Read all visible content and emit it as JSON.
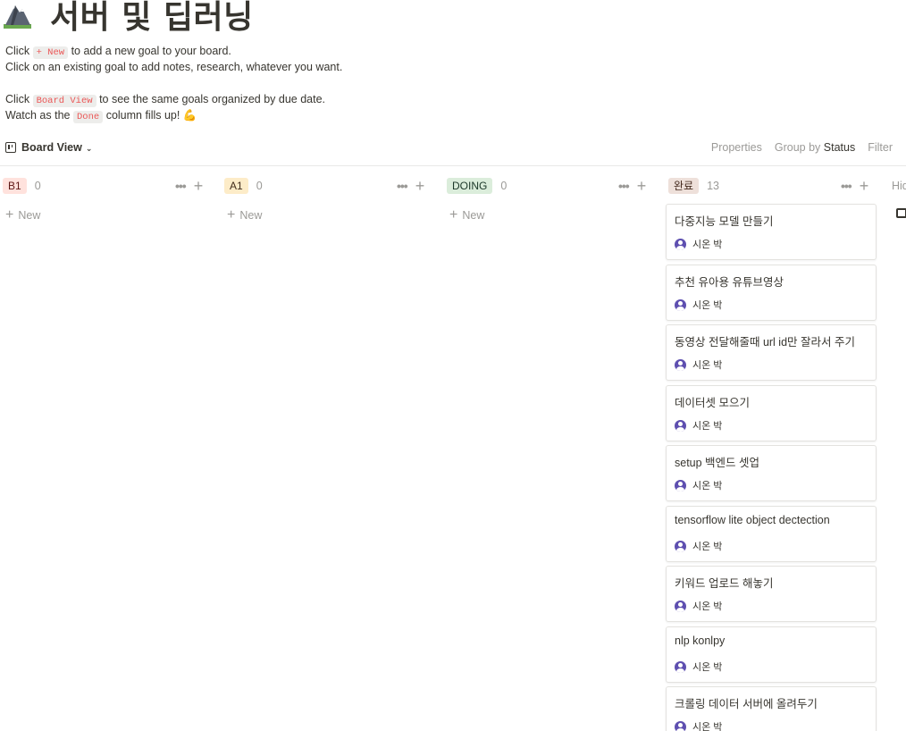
{
  "page": {
    "icon": "mountain-icon",
    "title": "서버 및 딥러닝"
  },
  "description": {
    "line1_prefix": "Click",
    "line1_code": "+ New",
    "line1_suffix": "to add a new goal to your board.",
    "line2": "Click on an existing goal to add notes, research, whatever you want.",
    "line3_prefix": "Click",
    "line3_code": "Board View",
    "line3_suffix": "to see the same goals organized by due date.",
    "line4_prefix": "Watch as the",
    "line4_code": "Done",
    "line4_suffix": "column fills up! 💪"
  },
  "view": {
    "name": "Board View",
    "properties": "Properties",
    "group_by_label": "Group by",
    "group_by_value": "Status",
    "filter": "Filter"
  },
  "columns": [
    {
      "label": "B1",
      "count": "0",
      "tag_bg": "#ffe2dd",
      "tag_color": "#5d1715",
      "new_label": "New"
    },
    {
      "label": "A1",
      "count": "0",
      "tag_bg": "#fdecc8",
      "tag_color": "#402c1b",
      "new_label": "New"
    },
    {
      "label": "DOING",
      "count": "0",
      "tag_bg": "#dbeddb",
      "tag_color": "#1c3829",
      "new_label": "New"
    },
    {
      "label": "완료",
      "count": "13",
      "tag_bg": "#eee0da",
      "tag_color": "#442a1e"
    }
  ],
  "cards": [
    {
      "title": "다중지능 모델 만들기",
      "person": "시온 박"
    },
    {
      "title": "추천 유아용 유튜브영상",
      "person": "시온 박"
    },
    {
      "title": "동영상 전달해줄때 url id만 잘라서 주기",
      "person": "시온 박"
    },
    {
      "title": "데이터셋 모으기",
      "person": "시온 박"
    },
    {
      "title": "setup 백엔드 셋업",
      "person": "시온 박"
    },
    {
      "title": "tensorflow lite object dectection",
      "person": "시온 박"
    },
    {
      "title": "키워드 업로드 해놓기",
      "person": "시온 박"
    },
    {
      "title": "nlp konlpy",
      "person": "시온 박"
    },
    {
      "title": "크롤링 데이터 서버에 올려두기",
      "person": "시온 박"
    }
  ],
  "hidden_column_label": "Hid"
}
